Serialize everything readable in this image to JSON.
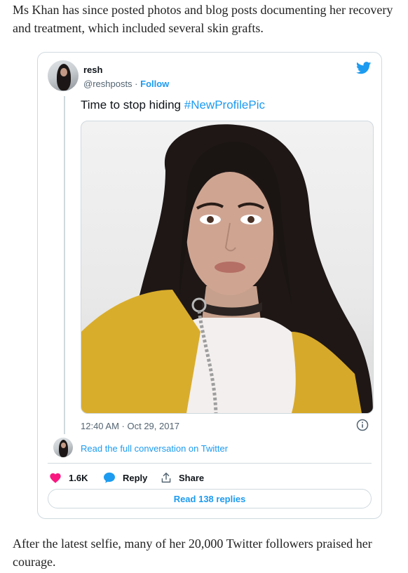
{
  "article": {
    "paragraph_top": "Ms Khan has since posted photos and blog posts documenting her recovery and treatment, which included several skin grafts.",
    "paragraph_bottom": "After the latest selfie, many of her 20,000 Twitter followers praised her courage."
  },
  "tweet": {
    "display_name": "resh",
    "handle": "@reshposts",
    "separator": " · ",
    "follow_label": "Follow",
    "text": "Time to stop hiding ",
    "hashtag": "#NewProfilePic",
    "timestamp": "12:40 AM · Oct 29, 2017",
    "read_conversation": "Read the full conversation on Twitter",
    "likes": "1.6K",
    "reply_label": "Reply",
    "share_label": "Share",
    "read_replies": "Read 138 replies",
    "colors": {
      "accent": "#1d9bf0",
      "like": "#f91880",
      "border": "#cfd9de",
      "secondary_text": "#536471"
    },
    "icons": [
      "twitter-bird-icon",
      "info-icon",
      "heart-icon",
      "reply-bubble-icon",
      "share-icon"
    ]
  }
}
